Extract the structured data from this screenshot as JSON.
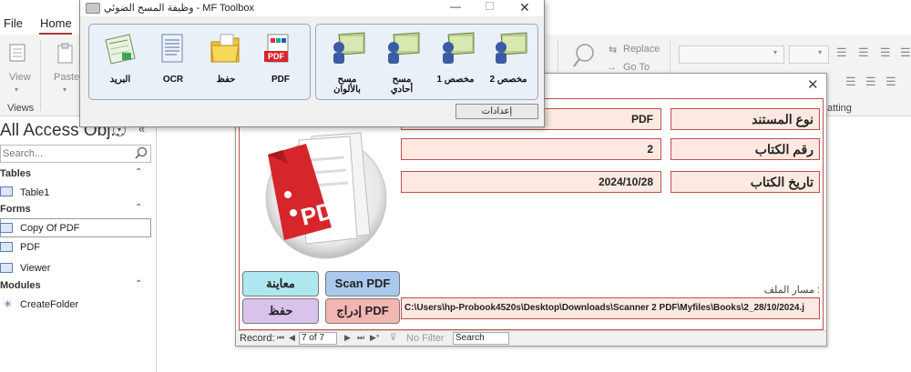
{
  "ribbon": {
    "tab_file": "File",
    "tab_home": "Home",
    "view_label": "View",
    "paste_label": "Paste",
    "views_group": "Views",
    "replace_label": "Replace",
    "goto_label": "Go To",
    "formatting_label": "atting"
  },
  "nav": {
    "title": "All Access Obj...",
    "search_placeholder": "Search...",
    "groups": [
      {
        "label": "Tables",
        "items": [
          "Table1"
        ]
      },
      {
        "label": "Forms",
        "items": [
          "Copy Of PDF",
          "PDF",
          "Viewer"
        ]
      },
      {
        "label": "Modules",
        "items": [
          "CreateFolder"
        ]
      }
    ]
  },
  "form": {
    "fields": [
      {
        "label": "نوع المستند",
        "value": "PDF"
      },
      {
        "label": "رقم الكتاب",
        "value": "2"
      },
      {
        "label": "تاريخ الكتاب",
        "value": "2024/10/28"
      }
    ],
    "path_label": "مسار الملف :",
    "path_value": "C:\\Users\\hp-Probook4520s\\Desktop\\Downloads\\Scanner 2 PDF\\Myfiles\\Books\\2_28/10/2024.j",
    "btn_preview": "معاينة",
    "btn_scan": "Scan PDF",
    "btn_save": "حفظ",
    "btn_insert": "إدراج PDF",
    "pdf_text": "PDF"
  },
  "recbar": {
    "record_label": "Record:",
    "record_value": "7 of 7",
    "filter_label": "No Filter",
    "search_label": "Search"
  },
  "toolbox": {
    "title": "وظيفة المسح الضوئي - MF Toolbox",
    "left_items": [
      "البريد",
      "OCR",
      "حفظ",
      "PDF"
    ],
    "right_items": [
      "مسح بالألوان",
      "مسح أحادي",
      "مخصص 1",
      "مخصص 2"
    ],
    "settings_label": "إعدادات"
  },
  "colors": {
    "field_bg": "#fde9e1",
    "field_border": "#c0504d",
    "btn_preview": "#aee7ef",
    "btn_scan": "#aac8ec",
    "btn_save": "#d9c2ec",
    "btn_insert": "#f4b6b3"
  }
}
